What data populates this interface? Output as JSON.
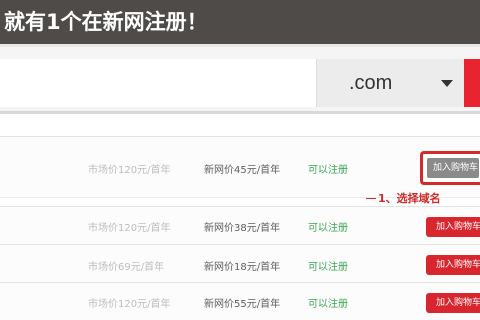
{
  "banner": {
    "text": "就有1个在新网注册！"
  },
  "search": {
    "value": "",
    "placeholder": "",
    "tld": ".com"
  },
  "annotation": {
    "text": "1、选择域名"
  },
  "results": [
    {
      "market_price": "市场价120元/首年",
      "new_price": "新网价45元/首年",
      "status": "可以注册",
      "button": "加入购物车"
    },
    {
      "market_price": "市场价120元/首年",
      "new_price": "新网价38元/首年",
      "status": "可以注册",
      "button": "加入购物车"
    },
    {
      "market_price": "市场价69元/首年",
      "new_price": "新网价18元/首年",
      "status": "可以注册",
      "button": "加入购物车"
    },
    {
      "market_price": "市场价120元/首年",
      "new_price": "新网价55元/首年",
      "status": "可以注册",
      "button": "加入购物车"
    }
  ],
  "colors": {
    "banner_bg": "#4e4b49",
    "accent_red": "#e7242f",
    "status_green": "#3aa650"
  }
}
